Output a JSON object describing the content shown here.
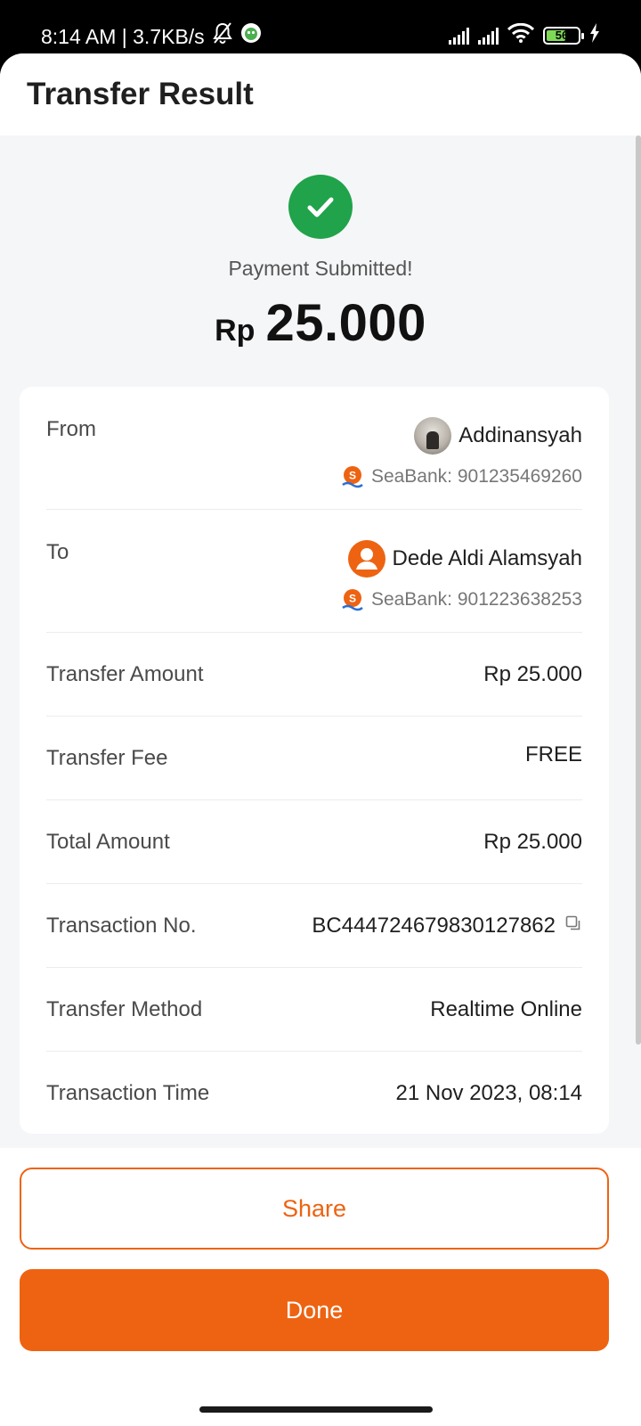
{
  "status_bar": {
    "time": "8:14 AM | 3.7KB/s",
    "battery": "56",
    "icons": [
      "mute-bell-icon",
      "app-notification-icon",
      "signal-icon",
      "signal-icon",
      "wifi-icon",
      "battery-icon",
      "charging-icon"
    ]
  },
  "header": {
    "title": "Transfer Result"
  },
  "result": {
    "icon": "check-circle-icon",
    "status_message": "Payment Submitted!",
    "currency": "Rp",
    "amount": "25.000"
  },
  "details": {
    "from": {
      "label": "From",
      "name": "Addinansyah",
      "bank": "SeaBank: 901235469260"
    },
    "to": {
      "label": "To",
      "name": "Dede Aldi Alamsyah",
      "bank": "SeaBank: 901223638253"
    },
    "transfer_amount": {
      "label": "Transfer Amount",
      "value": "Rp 25.000"
    },
    "transfer_fee": {
      "label": "Transfer Fee",
      "value": "FREE"
    },
    "total_amount": {
      "label": "Total Amount",
      "value": "Rp 25.000"
    },
    "transaction_no": {
      "label": "Transaction No.",
      "value": "BC444724679830127862"
    },
    "transfer_method": {
      "label": "Transfer Method",
      "value": "Realtime Online"
    },
    "transaction_time": {
      "label": "Transaction Time",
      "value": "21 Nov 2023, 08:14"
    }
  },
  "actions": {
    "share_label": "Share",
    "done_label": "Done"
  },
  "colors": {
    "accent": "#ee6311",
    "success": "#20a34a",
    "background": "#f5f6f8"
  }
}
